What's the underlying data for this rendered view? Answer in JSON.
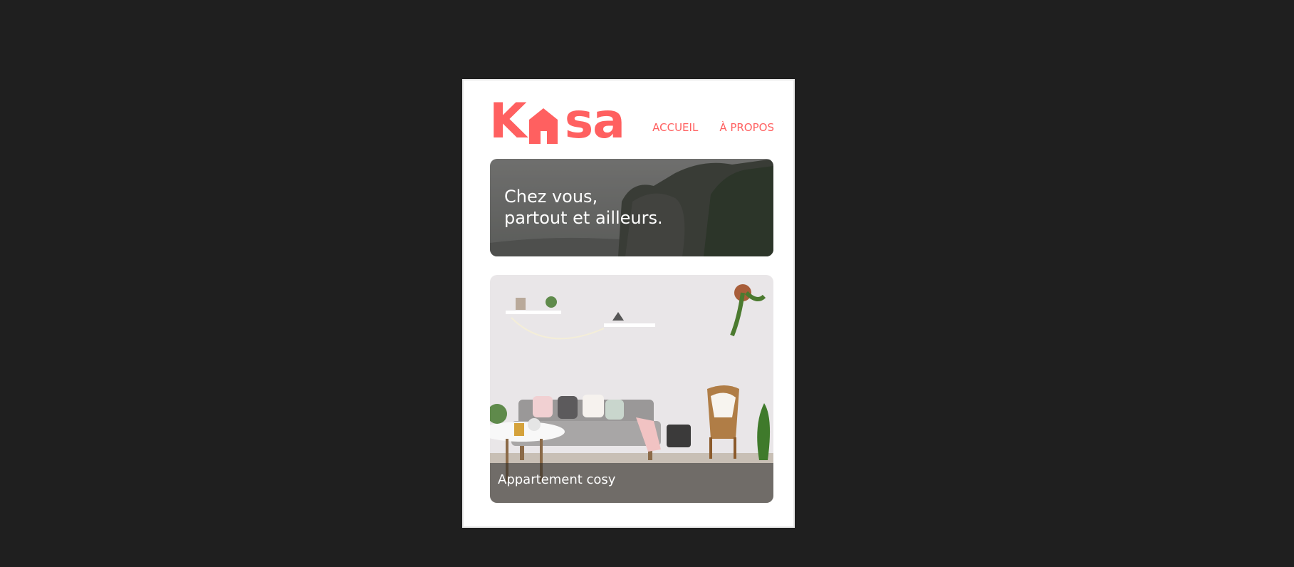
{
  "brand": {
    "logo_letters": [
      "K",
      "sa"
    ],
    "accent_color": "#ff6060",
    "logo_icon": "house-icon"
  },
  "nav": {
    "items": [
      {
        "label": "ACCUEIL"
      },
      {
        "label": "À PROPOS"
      }
    ]
  },
  "banner": {
    "line1": "Chez vous,",
    "line2": "partout et ailleurs.",
    "image": "coastal-cliffs-photo"
  },
  "listings": [
    {
      "title": "Appartement cosy",
      "image": "living-room-photo"
    }
  ]
}
